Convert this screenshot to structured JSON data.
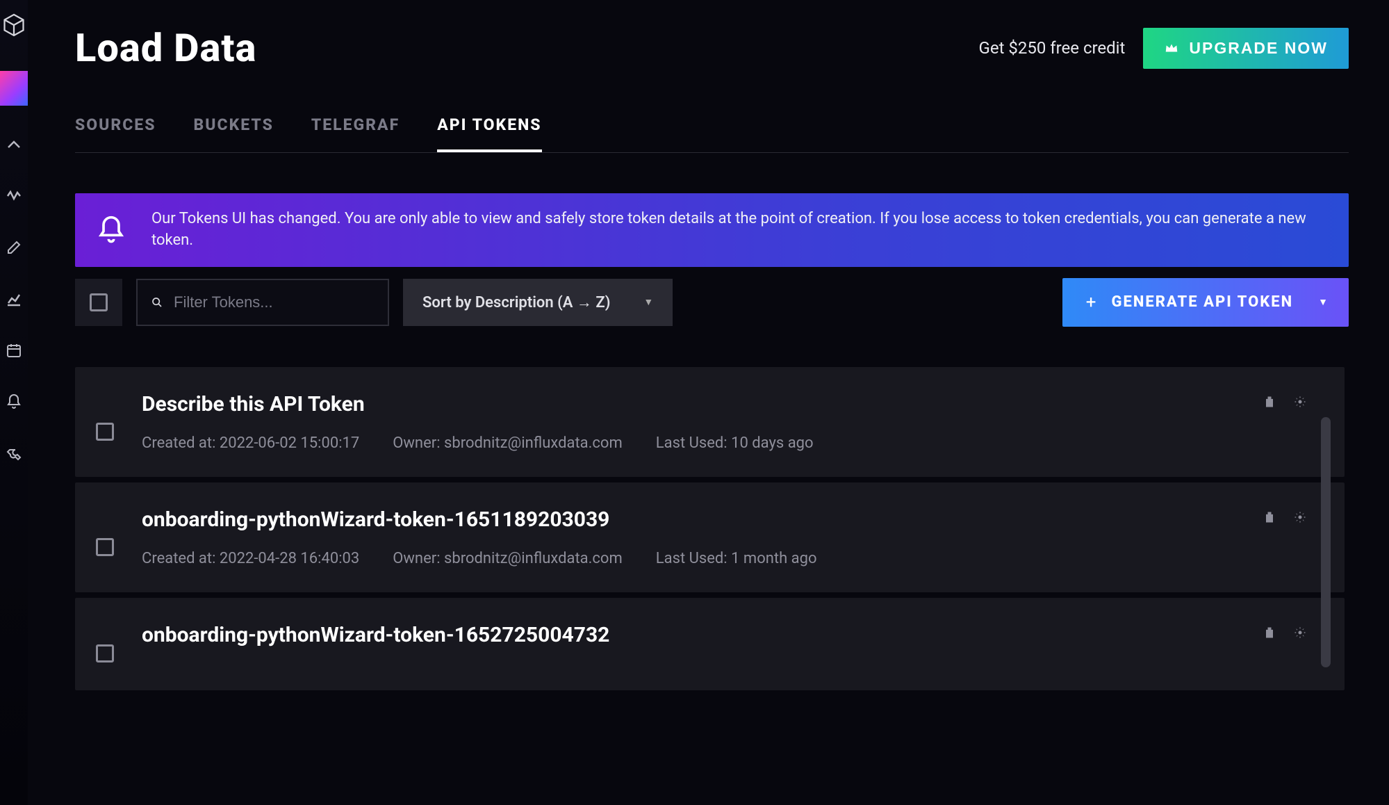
{
  "page": {
    "title": "Load Data",
    "credit_text": "Get $250 free credit",
    "upgrade_label": "UPGRADE NOW"
  },
  "tabs": [
    {
      "label": "SOURCES",
      "active": false
    },
    {
      "label": "BUCKETS",
      "active": false
    },
    {
      "label": "TELEGRAF",
      "active": false
    },
    {
      "label": "API TOKENS",
      "active": true
    }
  ],
  "banner": {
    "text": "Our Tokens UI has changed. You are only able to view and safely store token details at the point of creation. If you lose access to token credentials, you can generate a new token."
  },
  "controls": {
    "filter_placeholder": "Filter Tokens...",
    "sort_label": "Sort by Description (A → Z)",
    "generate_label": "GENERATE API TOKEN"
  },
  "meta_labels": {
    "created_prefix": "Created at: ",
    "owner_prefix": "Owner: ",
    "last_used_prefix": "Last Used: "
  },
  "tokens": [
    {
      "name": "Describe this API Token",
      "created_at": "2022-06-02 15:00:17",
      "owner": "sbrodnitz@influxdata.com",
      "last_used": "10 days ago"
    },
    {
      "name": "onboarding-pythonWizard-token-1651189203039",
      "created_at": "2022-04-28 16:40:03",
      "owner": "sbrodnitz@influxdata.com",
      "last_used": "1 month ago"
    },
    {
      "name": "onboarding-pythonWizard-token-1652725004732",
      "created_at": "",
      "owner": "",
      "last_used": ""
    }
  ]
}
